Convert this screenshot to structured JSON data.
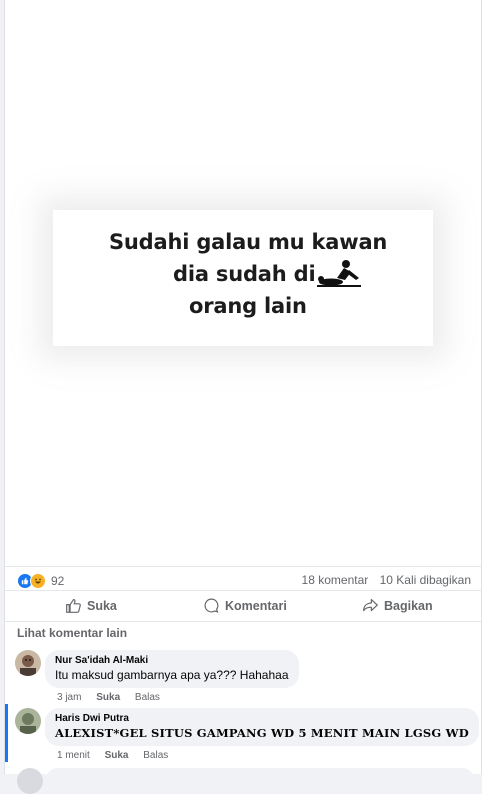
{
  "post": {
    "meme_text": [
      "Sudahi galau mu kawan",
      "dia sudah di",
      "orang lain"
    ],
    "reaction_count": "92",
    "comments_count": "18 komentar",
    "shares_count": "10 Kali dibagikan"
  },
  "actions": {
    "like": "Suka",
    "comment": "Komentari",
    "share": "Bagikan"
  },
  "see_more": "Lihat komentar lain",
  "comments": [
    {
      "name": "Nur Sa'idah Al-Maki",
      "text": "Itu maksud gambarnya apa ya??? Hahahaa",
      "time": "3 jam",
      "like": "Suka",
      "reply": "Balas"
    },
    {
      "name": "Haris Dwi Putra",
      "text": "ALEXIST*GEL SITUS GAMPANG WD 5 MENIT MAIN LGSG WD",
      "time": "1 menit",
      "like": "Suka",
      "reply": "Balas"
    }
  ],
  "colors": {
    "accent": "#1877f2",
    "muted": "#65676b",
    "bubble": "#f0f2f5"
  }
}
